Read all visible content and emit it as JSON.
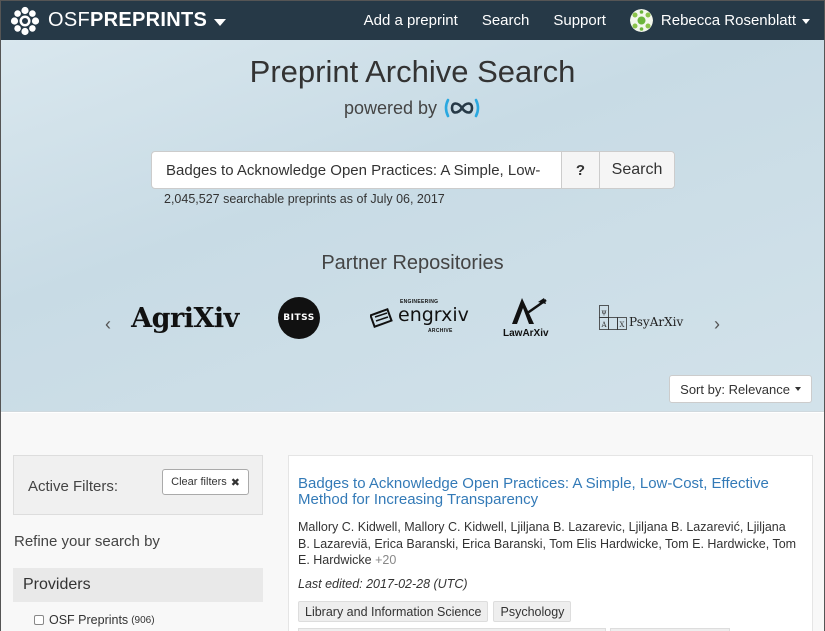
{
  "navbar": {
    "brand_light": "OSF",
    "brand_bold": "PREPRINTS",
    "links": [
      "Add a preprint",
      "Search",
      "Support"
    ],
    "user_name": "Rebecca Rosenblatt"
  },
  "hero": {
    "title": "Preprint Archive Search",
    "powered_by": "powered by",
    "search_value": "Badges to Acknowledge Open Practices: A Simple, Low-",
    "help_label": "?",
    "search_button": "Search",
    "count_text": "2,045,527 searchable preprints as of July 06, 2017",
    "partners_title": "Partner Repositories",
    "partners": [
      "AgriXiv",
      "BITSS",
      "engrxiv",
      "LawArXiv",
      "PsyArXiv"
    ],
    "engrxiv_top": "ENGINEERING",
    "engrxiv_bottom": "ARCHIVE",
    "sort_label": "Sort by: Relevance"
  },
  "sidebar": {
    "active_filters_label": "Active Filters:",
    "clear_filters_label": "Clear filters",
    "refine_label": "Refine your search by",
    "providers_label": "Providers",
    "provider_items": [
      {
        "name": "OSF Preprints",
        "count": "(906)"
      }
    ]
  },
  "result": {
    "title": "Badges to Acknowledge Open Practices: A Simple, Low-Cost, Effective Method for Increasing Transparency",
    "authors": "Mallory C. Kidwell, Mallory C. Kidwell, Ljiljana B. Lazarevic, Ljiljana B. Lazarević, Ljiljana B. Lazareviä, Erica Baranski, Erica Baranski, Tom Elis Hardwicke, Tom E. Hardwicke, Tom E. Hardwicke",
    "more": "+20",
    "last_edited": "Last edited: 2017-02-28 (UTC)",
    "tags": [
      "Library and Information Science",
      "Psychology"
    ]
  },
  "colors": {
    "navbar_bg": "#263947",
    "link_blue": "#337ab7",
    "share_blue": "#2aa8e0"
  }
}
